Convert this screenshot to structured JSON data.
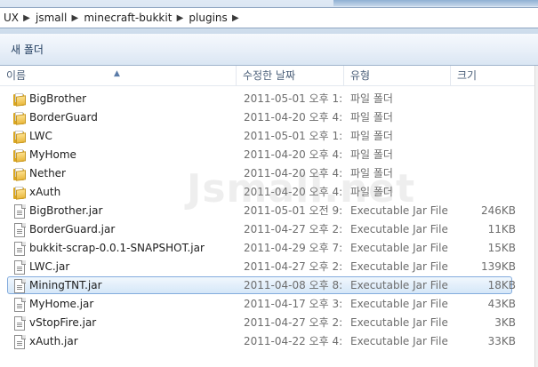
{
  "breadcrumb": [
    {
      "label": "UX"
    },
    {
      "label": "jsmall"
    },
    {
      "label": "minecraft-bukkit"
    },
    {
      "label": "plugins"
    }
  ],
  "commandbar": {
    "new_folder_label": "새 폴더"
  },
  "columns": {
    "name": "이름",
    "date": "수정한 날짜",
    "type": "유형",
    "size": "크기"
  },
  "watermark": "Jsmall.net",
  "files": [
    {
      "name": "BigBrother",
      "date": "2011-05-01 오후 1:...",
      "type": "파일 폴더",
      "size": "",
      "kind": "folder-icon",
      "selected": false
    },
    {
      "name": "BorderGuard",
      "date": "2011-04-20 오후 4:...",
      "type": "파일 폴더",
      "size": "",
      "kind": "folder-icon",
      "selected": false
    },
    {
      "name": "LWC",
      "date": "2011-05-01 오후 1:...",
      "type": "파일 폴더",
      "size": "",
      "kind": "folder-icon",
      "selected": false
    },
    {
      "name": "MyHome",
      "date": "2011-04-20 오후 4:...",
      "type": "파일 폴더",
      "size": "",
      "kind": "folder-icon",
      "selected": false
    },
    {
      "name": "Nether",
      "date": "2011-04-20 오후 4:...",
      "type": "파일 폴더",
      "size": "",
      "kind": "folder-icon",
      "selected": false
    },
    {
      "name": "xAuth",
      "date": "2011-04-20 오후 4:...",
      "type": "파일 폴더",
      "size": "",
      "kind": "folder-icon",
      "selected": false
    },
    {
      "name": "BigBrother.jar",
      "date": "2011-05-01 오전 9:...",
      "type": "Executable Jar File",
      "size": "246KB",
      "kind": "jar-file-icon",
      "selected": false
    },
    {
      "name": "BorderGuard.jar",
      "date": "2011-04-27 오후 2:...",
      "type": "Executable Jar File",
      "size": "11KB",
      "kind": "jar-file-icon",
      "selected": false
    },
    {
      "name": "bukkit-scrap-0.0.1-SNAPSHOT.jar",
      "date": "2011-04-29 오후 7:...",
      "type": "Executable Jar File",
      "size": "15KB",
      "kind": "jar-file-icon",
      "selected": false
    },
    {
      "name": "LWC.jar",
      "date": "2011-04-27 오후 2:...",
      "type": "Executable Jar File",
      "size": "139KB",
      "kind": "jar-file-icon",
      "selected": false
    },
    {
      "name": "MiningTNT.jar",
      "date": "2011-04-08 오후 8:...",
      "type": "Executable Jar File",
      "size": "18KB",
      "kind": "jar-file-icon",
      "selected": true
    },
    {
      "name": "MyHome.jar",
      "date": "2011-04-17 오후 3:...",
      "type": "Executable Jar File",
      "size": "43KB",
      "kind": "jar-file-icon",
      "selected": false
    },
    {
      "name": "vStopFire.jar",
      "date": "2011-04-27 오후 2:...",
      "type": "Executable Jar File",
      "size": "3KB",
      "kind": "jar-file-icon",
      "selected": false
    },
    {
      "name": "xAuth.jar",
      "date": "2011-04-22 오후 4:...",
      "type": "Executable Jar File",
      "size": "33KB",
      "kind": "jar-file-icon",
      "selected": false
    }
  ]
}
